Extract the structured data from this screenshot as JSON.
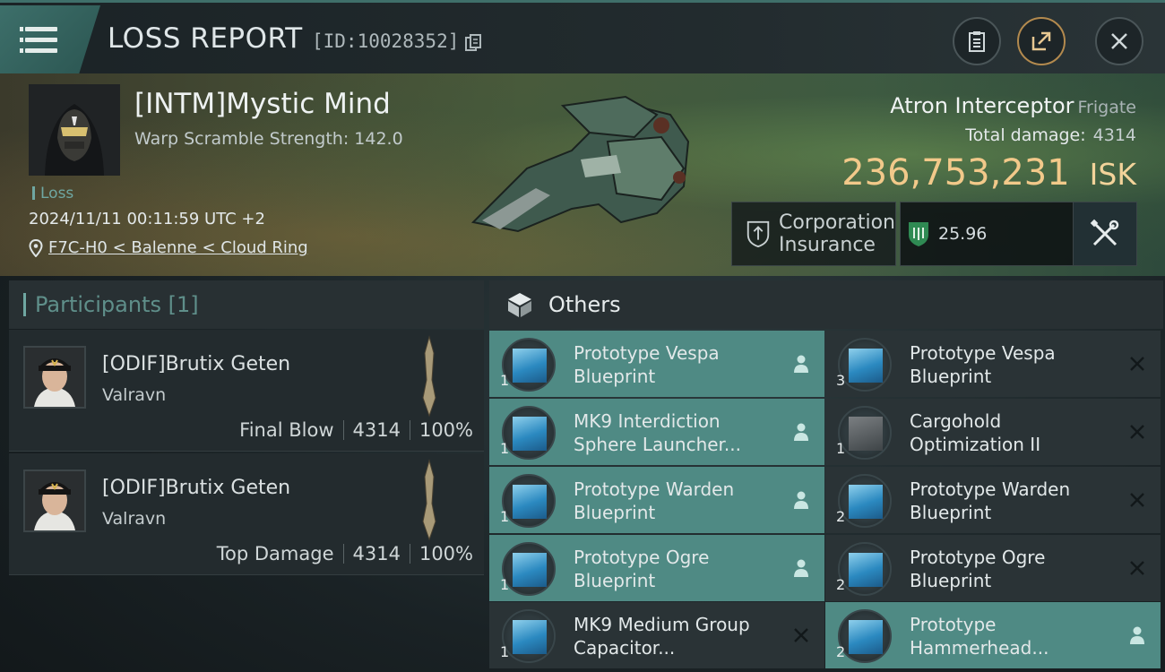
{
  "header": {
    "title": "LOSS REPORT",
    "report_id": "[ID:10028352]"
  },
  "victim": {
    "pilot_name": "[INTM]Mystic Mind",
    "warp_scramble": "Warp Scramble Strength: 142.0",
    "status": "Loss",
    "timestamp": "2024/11/11 00:11:59 UTC +2",
    "location": "F7C-H0 < Balenne < Cloud Ring",
    "ship_name": "Atron Interceptor",
    "ship_class": "Frigate",
    "total_damage_label": "Total damage:",
    "total_damage": "4314",
    "isk_value": "236,753,231",
    "isk_unit": "ISK",
    "insurance_label_1": "Corporation",
    "insurance_label_2": "Insurance",
    "insurance_value": "25.96"
  },
  "participants": {
    "title": "Participants [1]",
    "rows": [
      {
        "name": "[ODIF]Brutix Geten",
        "ship": "Valravn",
        "role": "Final Blow",
        "damage": "4314",
        "percent": "100%"
      },
      {
        "name": "[ODIF]Brutix Geten",
        "ship": "Valravn",
        "role": "Top Damage",
        "damage": "4314",
        "percent": "100%"
      }
    ]
  },
  "others": {
    "title": "Others",
    "items": [
      {
        "line1": "Prototype Vespa",
        "line2": "Blueprint",
        "qty": "1",
        "dropped": true,
        "icon": "blueprint-icon"
      },
      {
        "line1": "Prototype Vespa",
        "line2": "Blueprint",
        "qty": "3",
        "dropped": false,
        "icon": "blueprint-icon"
      },
      {
        "line1": "MK9 Interdiction",
        "line2": "Sphere Launcher...",
        "qty": "1",
        "dropped": true,
        "icon": "launcher-icon"
      },
      {
        "line1": "Cargohold",
        "line2": "Optimization II",
        "qty": "1",
        "dropped": false,
        "icon": "cargohold-icon"
      },
      {
        "line1": "Prototype Warden",
        "line2": "Blueprint",
        "qty": "1",
        "dropped": true,
        "icon": "blueprint-icon"
      },
      {
        "line1": "Prototype Warden",
        "line2": "Blueprint",
        "qty": "2",
        "dropped": false,
        "icon": "blueprint-icon"
      },
      {
        "line1": "Prototype Ogre",
        "line2": "Blueprint",
        "qty": "1",
        "dropped": true,
        "icon": "blueprint-icon"
      },
      {
        "line1": "Prototype Ogre",
        "line2": "Blueprint",
        "qty": "2",
        "dropped": false,
        "icon": "blueprint-icon"
      },
      {
        "line1": "MK9 Medium Group",
        "line2": "Capacitor...",
        "qty": "1",
        "dropped": false,
        "icon": "capacitor-icon"
      },
      {
        "line1": "Prototype",
        "line2": "Hammerhead...",
        "qty": "2",
        "dropped": true,
        "icon": "blueprint-icon"
      }
    ]
  },
  "colors": {
    "accent": "#4f8a84",
    "isk": "#f2c98a",
    "panel": "#2a3336"
  }
}
